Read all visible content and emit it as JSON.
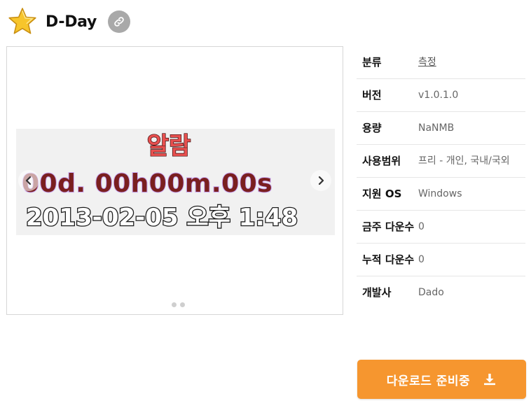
{
  "header": {
    "title": "D-Day",
    "icon": "star-icon",
    "link_icon": "link-icon"
  },
  "gallery": {
    "screenshot_lines": [
      "알람",
      "00d. 00h00m.00s",
      "2013-02-05 오후 1:48"
    ],
    "prev_icon": "chevron-left-icon",
    "next_icon": "chevron-right-icon",
    "dot_count": 2
  },
  "info": {
    "category": {
      "label": "분류",
      "value": "측정"
    },
    "version": {
      "label": "버전",
      "value": "v1.0.1.0"
    },
    "size": {
      "label": "용량",
      "value": "NaNMB"
    },
    "license": {
      "label": "사용범위",
      "value": "프리 - 개인, 국내/국외"
    },
    "os": {
      "label": "지원 OS",
      "value": "Windows"
    },
    "weekly_downloads": {
      "label": "금주 다운수",
      "value": "0"
    },
    "total_downloads": {
      "label": "누적 다운수",
      "value": "0"
    },
    "developer": {
      "label": "개발사",
      "value": "Dado"
    }
  },
  "download": {
    "label": "다운로드 준비중",
    "icon": "download-icon"
  },
  "colors": {
    "accent": "#f6962f",
    "star": "#f7c52b",
    "alarm_text": "#e8504f",
    "counter_text": "#7a1f1f",
    "date_text": "#ffffff"
  }
}
